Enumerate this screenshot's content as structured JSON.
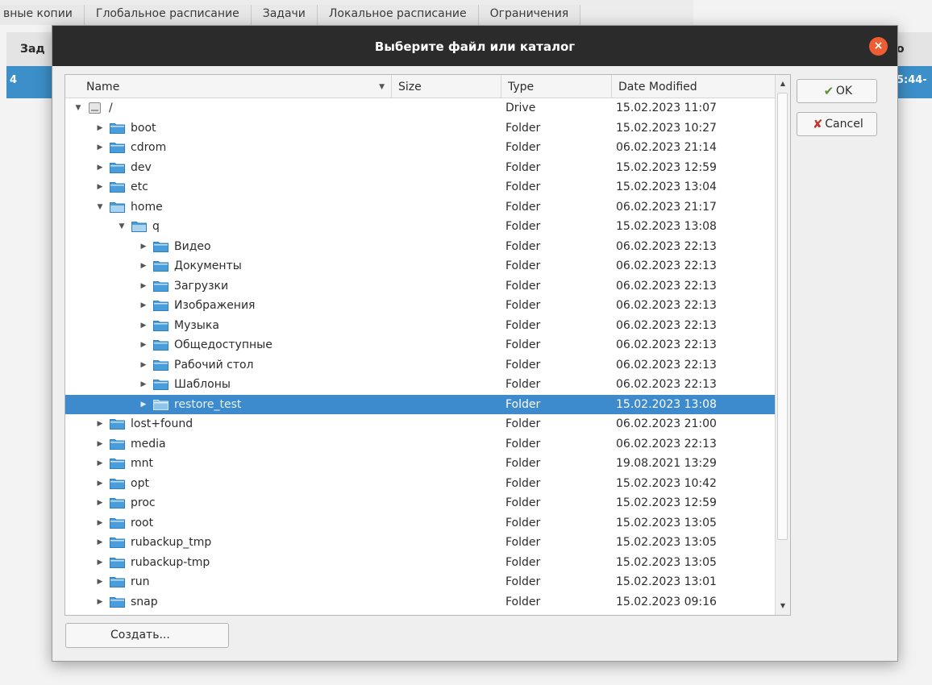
{
  "background": {
    "tabs": [
      "вные копии",
      "Глобальное расписание",
      "Задачи",
      "Локальное расписание",
      "Ограничения"
    ],
    "header_left": "Зад",
    "header_right": "о",
    "row_left": "4",
    "row_right": "5:44-"
  },
  "dialog": {
    "title": "Выберите файл или каталог",
    "close_label": "×",
    "columns": {
      "name": "Name",
      "size": "Size",
      "type": "Type",
      "date": "Date Modified"
    },
    "ok_label": "OK",
    "cancel_label": "Cancel",
    "create_label": "Создать...",
    "selected_row": "restore_test",
    "rows": [
      {
        "name": "/",
        "type": "Drive",
        "date": "15.02.2023 11:07",
        "level": 0,
        "expanded": true,
        "icon": "drive-icon"
      },
      {
        "name": "boot",
        "type": "Folder",
        "date": "15.02.2023 10:27",
        "level": 1,
        "expanded": false,
        "icon": "folder-icon"
      },
      {
        "name": "cdrom",
        "type": "Folder",
        "date": "06.02.2023 21:14",
        "level": 1,
        "expanded": false,
        "icon": "folder-icon"
      },
      {
        "name": "dev",
        "type": "Folder",
        "date": "15.02.2023 12:59",
        "level": 1,
        "expanded": false,
        "icon": "folder-icon"
      },
      {
        "name": "etc",
        "type": "Folder",
        "date": "15.02.2023 13:04",
        "level": 1,
        "expanded": false,
        "icon": "folder-icon"
      },
      {
        "name": "home",
        "type": "Folder",
        "date": "06.02.2023 21:17",
        "level": 1,
        "expanded": true,
        "icon": "folder-open-icon"
      },
      {
        "name": "q",
        "type": "Folder",
        "date": "15.02.2023 13:08",
        "level": 2,
        "expanded": true,
        "icon": "folder-open-icon"
      },
      {
        "name": "Видео",
        "type": "Folder",
        "date": "06.02.2023 22:13",
        "level": 3,
        "expanded": false,
        "icon": "folder-icon"
      },
      {
        "name": "Документы",
        "type": "Folder",
        "date": "06.02.2023 22:13",
        "level": 3,
        "expanded": false,
        "icon": "folder-icon"
      },
      {
        "name": "Загрузки",
        "type": "Folder",
        "date": "06.02.2023 22:13",
        "level": 3,
        "expanded": false,
        "icon": "folder-icon"
      },
      {
        "name": "Изображения",
        "type": "Folder",
        "date": "06.02.2023 22:13",
        "level": 3,
        "expanded": false,
        "icon": "folder-icon"
      },
      {
        "name": "Музыка",
        "type": "Folder",
        "date": "06.02.2023 22:13",
        "level": 3,
        "expanded": false,
        "icon": "folder-icon"
      },
      {
        "name": "Общедоступные",
        "type": "Folder",
        "date": "06.02.2023 22:13",
        "level": 3,
        "expanded": false,
        "icon": "folder-icon"
      },
      {
        "name": "Рабочий стол",
        "type": "Folder",
        "date": "06.02.2023 22:13",
        "level": 3,
        "expanded": false,
        "icon": "folder-icon"
      },
      {
        "name": "Шаблоны",
        "type": "Folder",
        "date": "06.02.2023 22:13",
        "level": 3,
        "expanded": false,
        "icon": "folder-icon"
      },
      {
        "name": "restore_test",
        "type": "Folder",
        "date": "15.02.2023 13:08",
        "level": 3,
        "expanded": false,
        "icon": "folder-icon"
      },
      {
        "name": "lost+found",
        "type": "Folder",
        "date": "06.02.2023 21:00",
        "level": 1,
        "expanded": false,
        "icon": "folder-icon"
      },
      {
        "name": "media",
        "type": "Folder",
        "date": "06.02.2023 22:13",
        "level": 1,
        "expanded": false,
        "icon": "folder-icon"
      },
      {
        "name": "mnt",
        "type": "Folder",
        "date": "19.08.2021 13:29",
        "level": 1,
        "expanded": false,
        "icon": "folder-icon"
      },
      {
        "name": "opt",
        "type": "Folder",
        "date": "15.02.2023 10:42",
        "level": 1,
        "expanded": false,
        "icon": "folder-icon"
      },
      {
        "name": "proc",
        "type": "Folder",
        "date": "15.02.2023 12:59",
        "level": 1,
        "expanded": false,
        "icon": "folder-icon"
      },
      {
        "name": "root",
        "type": "Folder",
        "date": "15.02.2023 13:05",
        "level": 1,
        "expanded": false,
        "icon": "folder-icon"
      },
      {
        "name": "rubackup_tmp",
        "type": "Folder",
        "date": "15.02.2023 13:05",
        "level": 1,
        "expanded": false,
        "icon": "folder-icon"
      },
      {
        "name": "rubackup-tmp",
        "type": "Folder",
        "date": "15.02.2023 13:05",
        "level": 1,
        "expanded": false,
        "icon": "folder-icon"
      },
      {
        "name": "run",
        "type": "Folder",
        "date": "15.02.2023 13:01",
        "level": 1,
        "expanded": false,
        "icon": "folder-icon"
      },
      {
        "name": "snap",
        "type": "Folder",
        "date": "15.02.2023 09:16",
        "level": 1,
        "expanded": false,
        "icon": "folder-icon"
      }
    ]
  },
  "colors": {
    "selection": "#3d8bcd",
    "titlebar": "#2b2b2b",
    "close": "#ef5e32",
    "folder": "#4a9ddb"
  }
}
